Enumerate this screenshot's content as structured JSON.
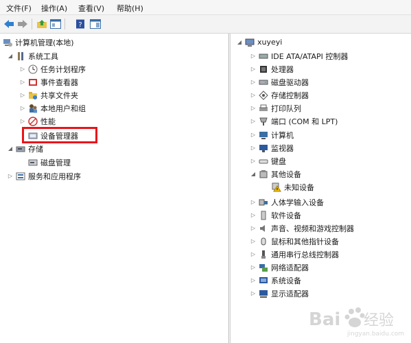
{
  "menu": {
    "file": "文件(F)",
    "action": "操作(A)",
    "view": "查看(V)",
    "help": "帮助(H)"
  },
  "left_tree": {
    "root": "计算机管理(本地)",
    "system_tools": "系统工具",
    "task_scheduler": "任务计划程序",
    "event_viewer": "事件查看器",
    "shared_folders": "共享文件夹",
    "local_users": "本地用户和组",
    "performance": "性能",
    "device_manager": "设备管理器",
    "storage": "存储",
    "disk_management": "磁盘管理",
    "services_apps": "服务和应用程序"
  },
  "right_tree": {
    "computer_name": "xuyeyi",
    "items": [
      "IDE ATA/ATAPI 控制器",
      "处理器",
      "磁盘驱动器",
      "存储控制器",
      "打印队列",
      "端口 (COM 和 LPT)",
      "计算机",
      "监视器",
      "键盘",
      "其他设备",
      "未知设备",
      "人体学输入设备",
      "软件设备",
      "声音、视频和游戏控制器",
      "鼠标和其他指针设备",
      "通用串行总线控制器",
      "网络适配器",
      "系统设备",
      "显示适配器"
    ]
  },
  "colors": {
    "highlight_border": "#e8141b",
    "toolbar_bg": "#f3f3f3"
  }
}
